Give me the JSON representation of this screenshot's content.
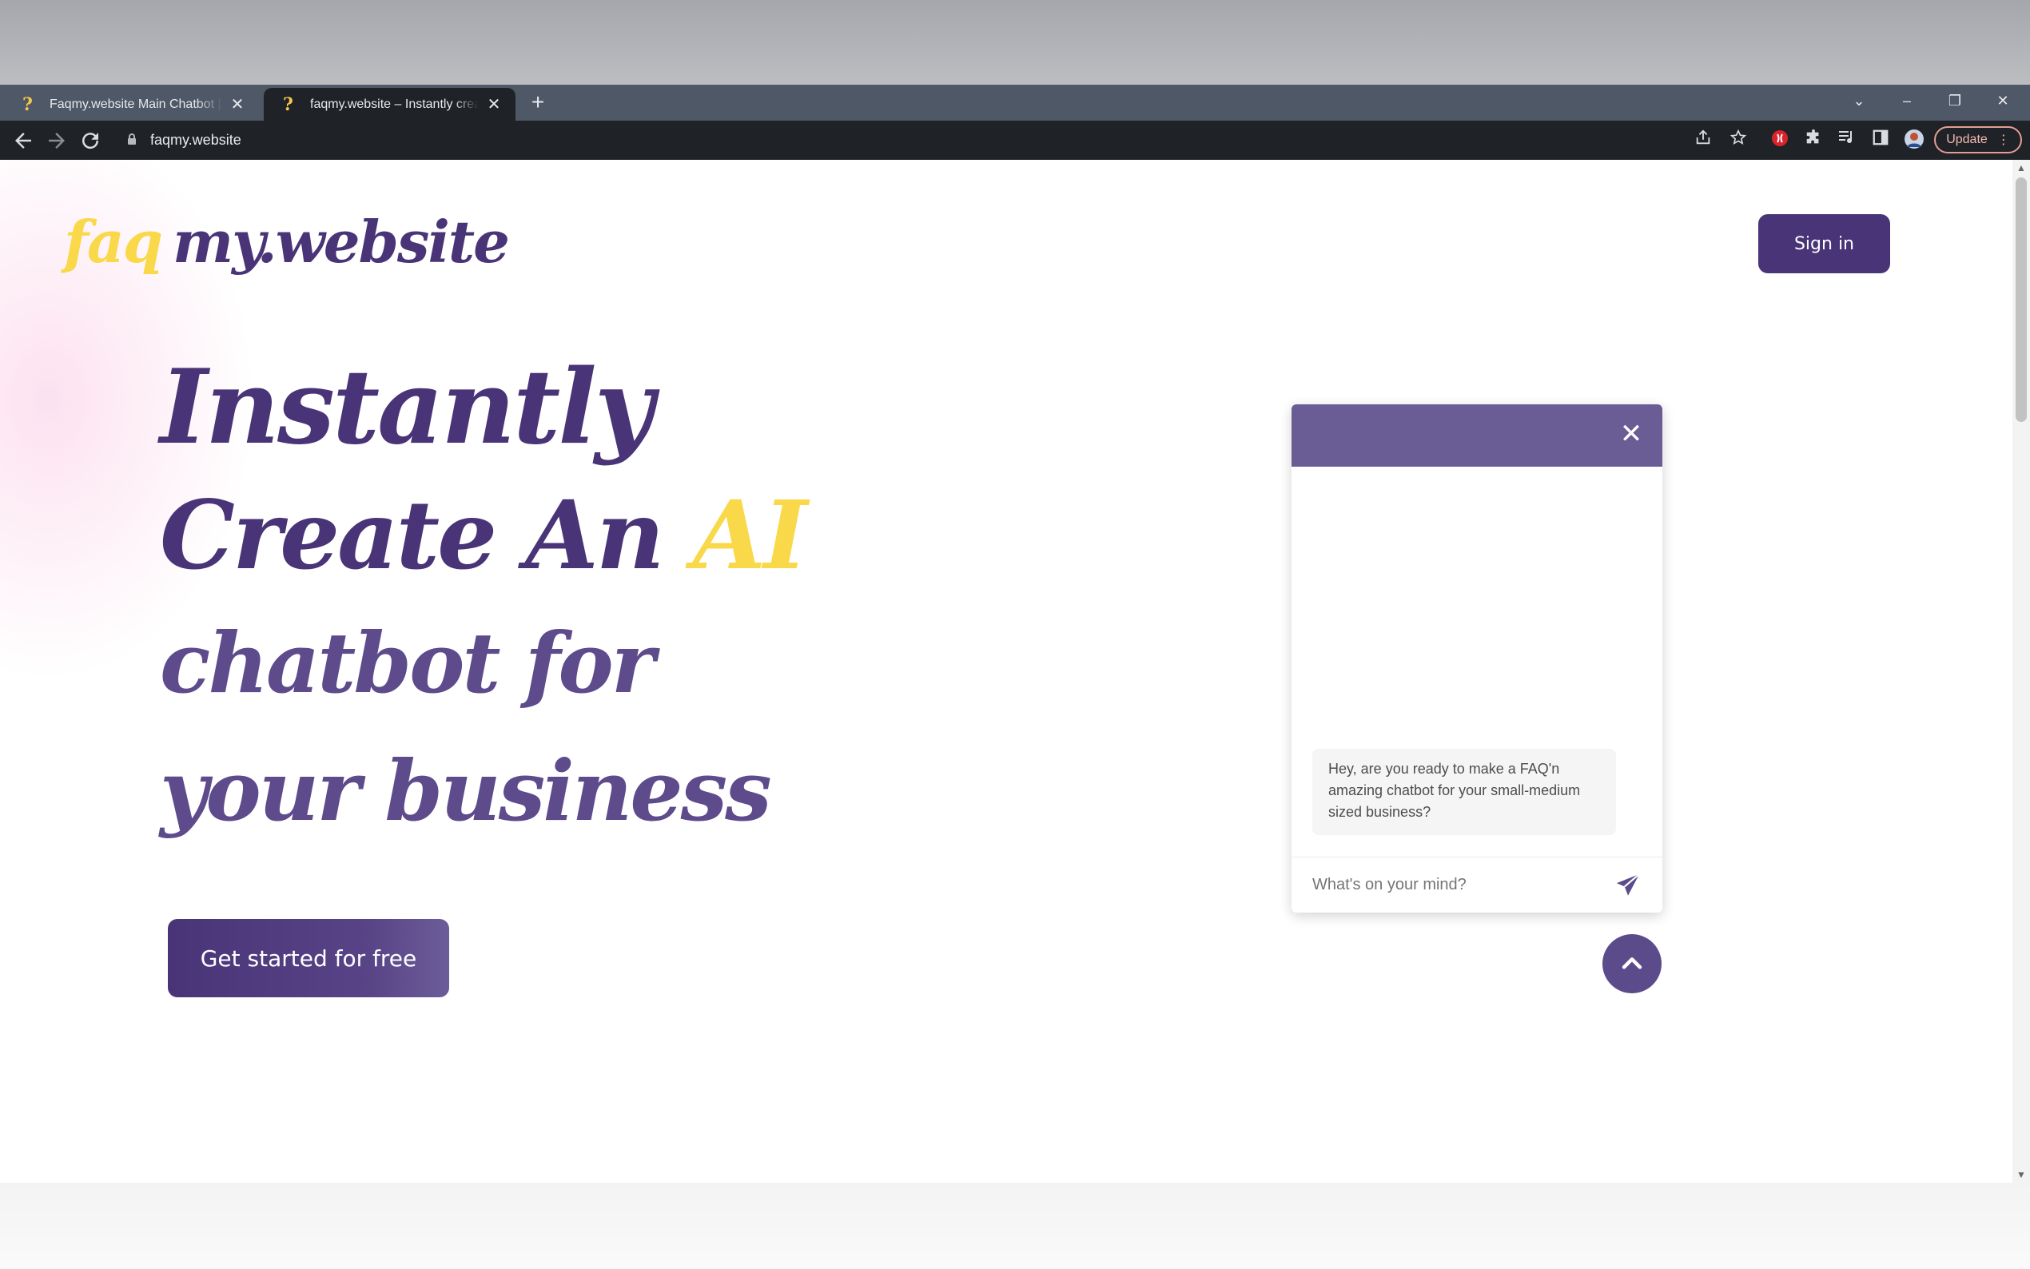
{
  "browser": {
    "tabs": [
      {
        "title": "Faqmy.website Main Chatbot | Faqmy.website",
        "active": false
      },
      {
        "title": "faqmy.website – Instantly create an AI chatbot",
        "active": true
      }
    ],
    "new_tab_glyph": "+",
    "tab_close_glyph": "✕",
    "url": "faqmy.website",
    "update_label": "Update",
    "window_controls": {
      "chevron": "⌄",
      "minimize": "–",
      "restore": "❐",
      "close": "✕"
    }
  },
  "site": {
    "logo": {
      "faq": "faq",
      "rest": "my.website"
    },
    "signin_label": "Sign in",
    "hero": {
      "line1": "Instantly",
      "line2_main": "Create An ",
      "line2_accent": "AI",
      "line3": "chatbot for",
      "line4": "your business"
    },
    "cta_label": "Get started for free"
  },
  "chat": {
    "close_glyph": "✕",
    "bot_message": "Hey, are you ready to make a FAQ'n amazing chatbot for your small-medium sized business?",
    "input_placeholder": "What's on your mind?"
  },
  "colors": {
    "brand_purple": "#4a3478",
    "brand_yellow": "#f9d84a",
    "widget_header": "#6a5c94"
  },
  "icons": [
    "favicon-question-icon",
    "back-arrow-icon",
    "forward-arrow-icon",
    "reload-icon",
    "lock-icon",
    "share-icon",
    "star-icon",
    "extension-icon",
    "puzzle-icon",
    "media-icon",
    "sidebar-icon",
    "profile-avatar",
    "kebab-menu-icon",
    "close-icon",
    "send-icon",
    "chevron-up-icon"
  ]
}
